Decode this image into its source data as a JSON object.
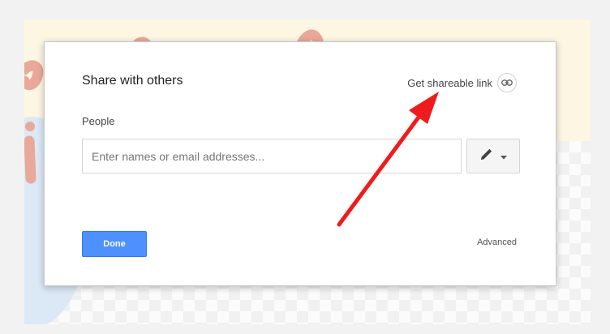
{
  "dialog": {
    "title": "Share with others",
    "share_link_label": "Get shareable link",
    "share_link_icon": "link-icon",
    "people_label": "People",
    "names_input": {
      "value": "",
      "placeholder": "Enter names or email addresses..."
    },
    "permission_button_icon": "pencil-icon",
    "done_label": "Done",
    "advanced_label": "Advanced"
  },
  "annotation": {
    "arrow_color": "#ee1c1c"
  },
  "colors": {
    "primary_button": "#4d90fe",
    "backdrop_cream": "#fdf6e3",
    "decor_script": "#e9a89a"
  }
}
